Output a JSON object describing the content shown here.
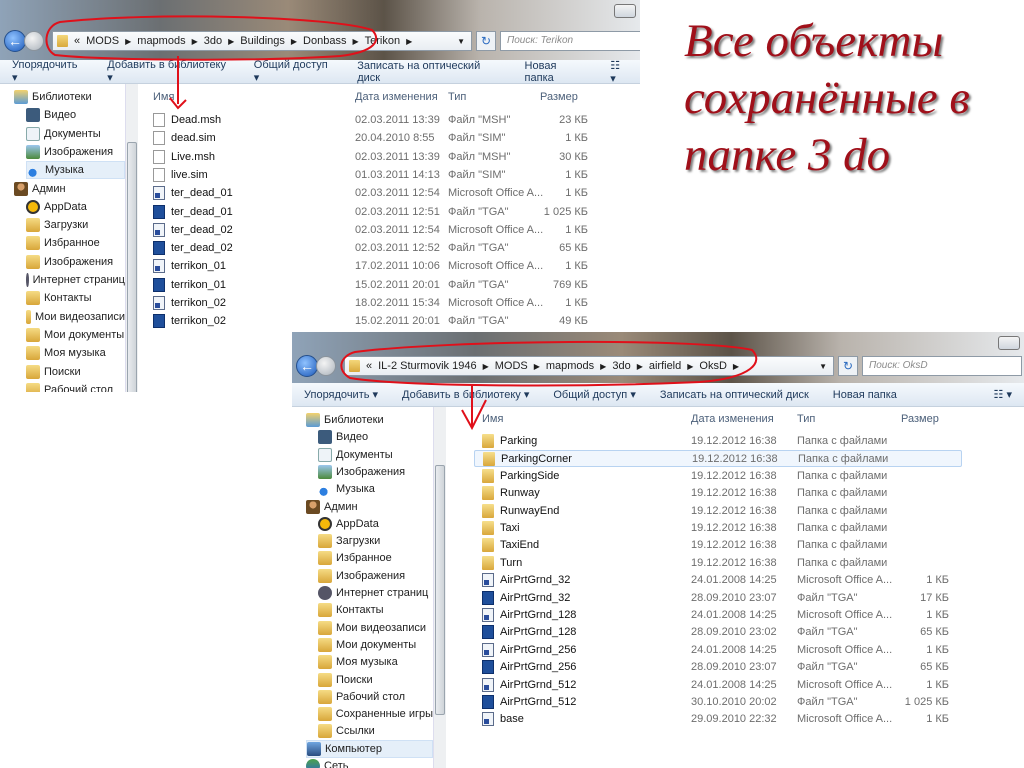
{
  "annotation": {
    "lines": [
      "Все объекты",
      "сохранённые в",
      "папке 3 do"
    ]
  },
  "toolbar": {
    "organize": "Упорядочить ▾",
    "add_library": "Добавить в библиотеку ▾",
    "share": "Общий доступ ▾",
    "burn": "Записать на оптический диск",
    "new_folder": "Новая папка",
    "view": "☷ ▾"
  },
  "columns": {
    "name": "Имя",
    "date": "Дата изменения",
    "type": "Тип",
    "size": "Размер"
  },
  "window1": {
    "path": [
      "«",
      "MODS",
      "mapmods",
      "3do",
      "Buildings",
      "Donbass",
      "Terikon"
    ],
    "search_placeholder": "Поиск: Terikon",
    "sidebar": [
      {
        "label": "Библиотеки",
        "icon": "i-lib",
        "level": 0
      },
      {
        "label": "Видео",
        "icon": "i-vid",
        "level": 1
      },
      {
        "label": "Документы",
        "icon": "i-doc",
        "level": 1
      },
      {
        "label": "Изображения",
        "icon": "i-img",
        "level": 1
      },
      {
        "label": "Музыка",
        "icon": "i-mus",
        "level": 1,
        "selected": true
      },
      {
        "label": "Админ",
        "icon": "i-user",
        "level": 0
      },
      {
        "label": "AppData",
        "icon": "i-app",
        "level": 1
      },
      {
        "label": "Загрузки",
        "icon": "i-fold",
        "level": 1
      },
      {
        "label": "Избранное",
        "icon": "i-fold",
        "level": 1
      },
      {
        "label": "Изображения",
        "icon": "i-fold",
        "level": 1
      },
      {
        "label": "Интернет страниц",
        "icon": "i-ie",
        "level": 1
      },
      {
        "label": "Контакты",
        "icon": "i-fold",
        "level": 1
      },
      {
        "label": "Мои видеозаписи",
        "icon": "i-fold",
        "level": 1
      },
      {
        "label": "Мои документы",
        "icon": "i-fold",
        "level": 1
      },
      {
        "label": "Моя музыка",
        "icon": "i-fold",
        "level": 1
      },
      {
        "label": "Поиски",
        "icon": "i-fold",
        "level": 1
      },
      {
        "label": "Рабочий стол",
        "icon": "i-fold",
        "level": 1
      }
    ],
    "files": [
      {
        "name": "Dead.msh",
        "date": "02.03.2011 13:39",
        "type": "Файл \"MSH\"",
        "size": "23 КБ",
        "icon": "blank"
      },
      {
        "name": "dead.sim",
        "date": "20.04.2010 8:55",
        "type": "Файл \"SIM\"",
        "size": "1 КБ",
        "icon": "blank"
      },
      {
        "name": "Live.msh",
        "date": "02.03.2011 13:39",
        "type": "Файл \"MSH\"",
        "size": "30 КБ",
        "icon": "blank"
      },
      {
        "name": "live.sim",
        "date": "01.03.2011 14:13",
        "type": "Файл \"SIM\"",
        "size": "1 КБ",
        "icon": "blank"
      },
      {
        "name": "ter_dead_01",
        "date": "02.03.2011 12:54",
        "type": "Microsoft Office A...",
        "size": "1 КБ",
        "icon": "office"
      },
      {
        "name": "ter_dead_01",
        "date": "02.03.2011 12:51",
        "type": "Файл \"TGA\"",
        "size": "1 025 КБ",
        "icon": "tga"
      },
      {
        "name": "ter_dead_02",
        "date": "02.03.2011 12:54",
        "type": "Microsoft Office A...",
        "size": "1 КБ",
        "icon": "office"
      },
      {
        "name": "ter_dead_02",
        "date": "02.03.2011 12:52",
        "type": "Файл \"TGA\"",
        "size": "65 КБ",
        "icon": "tga"
      },
      {
        "name": "terrikon_01",
        "date": "17.02.2011 10:06",
        "type": "Microsoft Office A...",
        "size": "1 КБ",
        "icon": "office"
      },
      {
        "name": "terrikon_01",
        "date": "15.02.2011 20:01",
        "type": "Файл \"TGA\"",
        "size": "769 КБ",
        "icon": "tga"
      },
      {
        "name": "terrikon_02",
        "date": "18.02.2011 15:34",
        "type": "Microsoft Office A...",
        "size": "1 КБ",
        "icon": "office"
      },
      {
        "name": "terrikon_02",
        "date": "15.02.2011 20:01",
        "type": "Файл \"TGA\"",
        "size": "49 КБ",
        "icon": "tga"
      }
    ]
  },
  "window2": {
    "path": [
      "«",
      "IL-2 Sturmovik 1946",
      "MODS",
      "mapmods",
      "3do",
      "airfield",
      "OksD"
    ],
    "search_placeholder": "Поиск: OksD",
    "sidebar": [
      {
        "label": "Библиотеки",
        "icon": "i-lib",
        "level": 0
      },
      {
        "label": "Видео",
        "icon": "i-vid",
        "level": 1
      },
      {
        "label": "Документы",
        "icon": "i-doc",
        "level": 1
      },
      {
        "label": "Изображения",
        "icon": "i-img",
        "level": 1
      },
      {
        "label": "Музыка",
        "icon": "i-mus",
        "level": 1
      },
      {
        "label": "Админ",
        "icon": "i-user",
        "level": 0
      },
      {
        "label": "AppData",
        "icon": "i-app",
        "level": 1
      },
      {
        "label": "Загрузки",
        "icon": "i-fold",
        "level": 1
      },
      {
        "label": "Избранное",
        "icon": "i-fold",
        "level": 1
      },
      {
        "label": "Изображения",
        "icon": "i-fold",
        "level": 1
      },
      {
        "label": "Интернет страниц",
        "icon": "i-ie",
        "level": 1
      },
      {
        "label": "Контакты",
        "icon": "i-fold",
        "level": 1
      },
      {
        "label": "Мои видеозаписи",
        "icon": "i-fold",
        "level": 1
      },
      {
        "label": "Мои документы",
        "icon": "i-fold",
        "level": 1
      },
      {
        "label": "Моя музыка",
        "icon": "i-fold",
        "level": 1
      },
      {
        "label": "Поиски",
        "icon": "i-fold",
        "level": 1
      },
      {
        "label": "Рабочий стол",
        "icon": "i-fold",
        "level": 1
      },
      {
        "label": "Сохраненные игры",
        "icon": "i-fold",
        "level": 1
      },
      {
        "label": "Ссылки",
        "icon": "i-fold",
        "level": 1
      },
      {
        "label": "Компьютер",
        "icon": "i-pc",
        "level": 0,
        "selected": true
      },
      {
        "label": "Сеть",
        "icon": "i-net",
        "level": 0
      }
    ],
    "files": [
      {
        "name": "Parking",
        "date": "19.12.2012 16:38",
        "type": "Папка с файлами",
        "size": "",
        "icon": "folder"
      },
      {
        "name": "ParkingCorner",
        "date": "19.12.2012 16:38",
        "type": "Папка с файлами",
        "size": "",
        "icon": "folder",
        "selected": true
      },
      {
        "name": "ParkingSide",
        "date": "19.12.2012 16:38",
        "type": "Папка с файлами",
        "size": "",
        "icon": "folder"
      },
      {
        "name": "Runway",
        "date": "19.12.2012 16:38",
        "type": "Папка с файлами",
        "size": "",
        "icon": "folder"
      },
      {
        "name": "RunwayEnd",
        "date": "19.12.2012 16:38",
        "type": "Папка с файлами",
        "size": "",
        "icon": "folder"
      },
      {
        "name": "Taxi",
        "date": "19.12.2012 16:38",
        "type": "Папка с файлами",
        "size": "",
        "icon": "folder"
      },
      {
        "name": "TaxiEnd",
        "date": "19.12.2012 16:38",
        "type": "Папка с файлами",
        "size": "",
        "icon": "folder"
      },
      {
        "name": "Turn",
        "date": "19.12.2012 16:38",
        "type": "Папка с файлами",
        "size": "",
        "icon": "folder"
      },
      {
        "name": "AirPrtGrnd_32",
        "date": "24.01.2008 14:25",
        "type": "Microsoft Office A...",
        "size": "1 КБ",
        "icon": "office"
      },
      {
        "name": "AirPrtGrnd_32",
        "date": "28.09.2010 23:07",
        "type": "Файл \"TGA\"",
        "size": "17 КБ",
        "icon": "tga"
      },
      {
        "name": "AirPrtGrnd_128",
        "date": "24.01.2008 14:25",
        "type": "Microsoft Office A...",
        "size": "1 КБ",
        "icon": "office"
      },
      {
        "name": "AirPrtGrnd_128",
        "date": "28.09.2010 23:02",
        "type": "Файл \"TGA\"",
        "size": "65 КБ",
        "icon": "tga"
      },
      {
        "name": "AirPrtGrnd_256",
        "date": "24.01.2008 14:25",
        "type": "Microsoft Office A...",
        "size": "1 КБ",
        "icon": "office"
      },
      {
        "name": "AirPrtGrnd_256",
        "date": "28.09.2010 23:07",
        "type": "Файл \"TGA\"",
        "size": "65 КБ",
        "icon": "tga"
      },
      {
        "name": "AirPrtGrnd_512",
        "date": "24.01.2008 14:25",
        "type": "Microsoft Office A...",
        "size": "1 КБ",
        "icon": "office"
      },
      {
        "name": "AirPrtGrnd_512",
        "date": "30.10.2010 20:02",
        "type": "Файл \"TGA\"",
        "size": "1 025 КБ",
        "icon": "tga"
      },
      {
        "name": "base",
        "date": "29.09.2010 22:32",
        "type": "Microsoft Office A...",
        "size": "1 КБ",
        "icon": "office"
      }
    ]
  }
}
